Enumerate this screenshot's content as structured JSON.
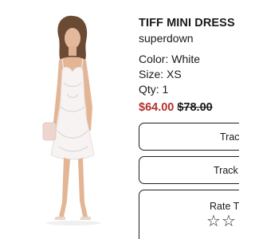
{
  "product": {
    "name": "TIFF MINI DRESS",
    "brand": "superdown",
    "color": "Color: White",
    "size": "Size: XS",
    "qty": "Qty: 1",
    "sale_price": "$64.00",
    "original_price": "$78.00",
    "image_icon": "dress-photo"
  },
  "actions": {
    "track_1": "Trac",
    "track_2": "Track",
    "rate": "Rate T",
    "star_1": "☆",
    "star_2": "☆"
  },
  "colors": {
    "sale": "#b5302e",
    "border": "#1f1f1f"
  }
}
